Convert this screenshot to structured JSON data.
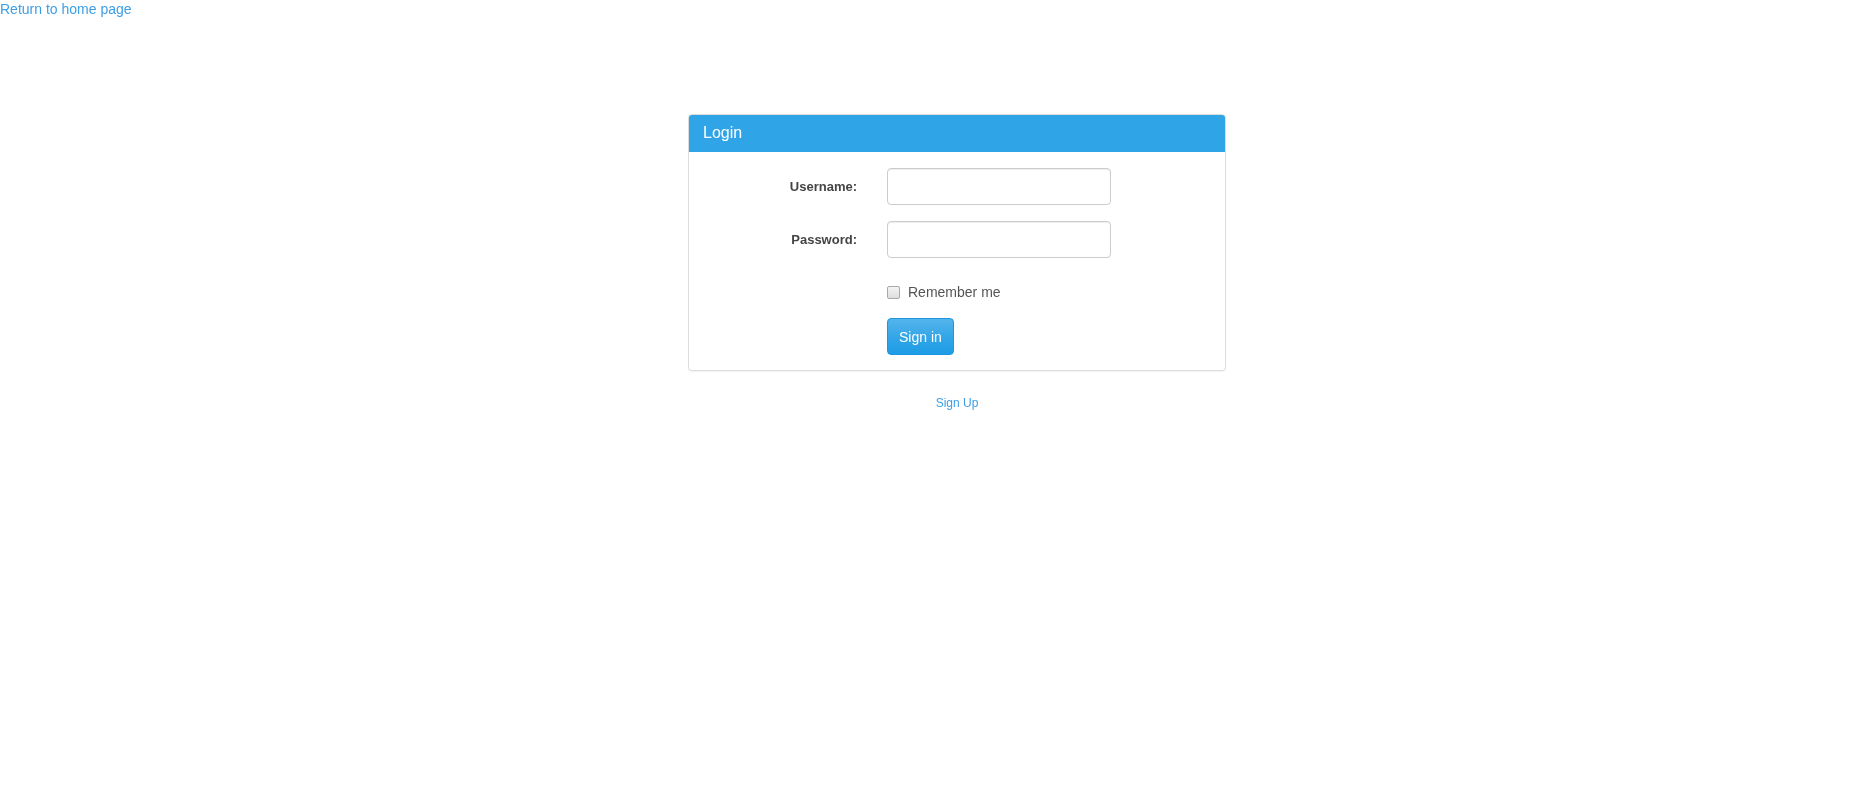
{
  "top_link": {
    "label": "Return to home page"
  },
  "login_panel": {
    "title": "Login",
    "fields": [
      {
        "label": "Username:"
      },
      {
        "label": "Password:"
      }
    ],
    "remember": {
      "label": "Remember me",
      "checked": false
    },
    "submit": {
      "label": "Sign in"
    }
  },
  "sign_up_link": {
    "label": "Sign Up"
  }
}
